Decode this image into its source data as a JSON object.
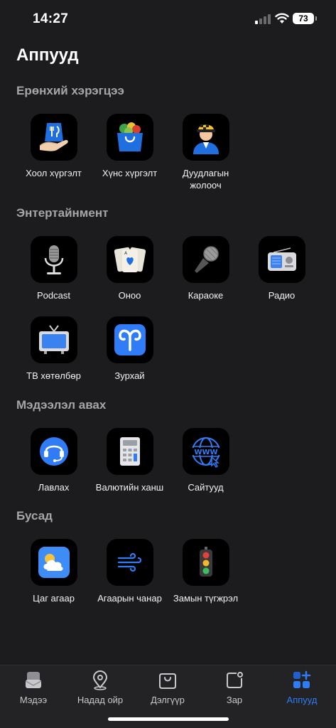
{
  "status": {
    "time": "14:27",
    "battery": "73"
  },
  "page": {
    "title": "Аппууд"
  },
  "sections": [
    {
      "title": "Ерөнхий хэрэгцээ",
      "apps": [
        {
          "label": "Хоол хүргэлт",
          "icon": "food-delivery-icon"
        },
        {
          "label": "Хүнс хүргэлт",
          "icon": "grocery-bag-icon"
        },
        {
          "label": "Дуудлагын жолооч",
          "icon": "driver-icon"
        }
      ]
    },
    {
      "title": "Энтертайнмент",
      "apps": [
        {
          "label": "Podcast",
          "icon": "microphone-icon"
        },
        {
          "label": "Оноо",
          "icon": "playing-cards-icon"
        },
        {
          "label": "Караоке",
          "icon": "karaoke-mic-icon"
        },
        {
          "label": "Радио",
          "icon": "radio-icon"
        },
        {
          "label": "ТВ хөтөлбөр",
          "icon": "tv-icon"
        },
        {
          "label": "Зурхай",
          "icon": "aries-icon"
        }
      ]
    },
    {
      "title": "Мэдээлэл авах",
      "apps": [
        {
          "label": "Лавлах",
          "icon": "headset-icon"
        },
        {
          "label": "Валютийн ханш",
          "icon": "calculator-icon"
        },
        {
          "label": "Сайтууд",
          "icon": "www-icon"
        }
      ]
    },
    {
      "title": "Бусад",
      "apps": [
        {
          "label": "Цаг агаар",
          "icon": "weather-icon"
        },
        {
          "label": "Агаарын чанар",
          "icon": "wind-icon"
        },
        {
          "label": "Замын түгжрэл",
          "icon": "traffic-light-icon"
        }
      ]
    }
  ],
  "tabs": [
    {
      "label": "Мэдээ",
      "icon": "news-icon",
      "active": false
    },
    {
      "label": "Надад ойр",
      "icon": "location-pin-icon",
      "active": false
    },
    {
      "label": "Дэлгүүр",
      "icon": "shopping-bag-icon",
      "active": false
    },
    {
      "label": "Зар",
      "icon": "ads-icon",
      "active": false
    },
    {
      "label": "Аппууд",
      "icon": "apps-grid-icon",
      "active": true
    }
  ],
  "colors": {
    "background": "#1c1c1e",
    "section_title": "#a6a6aa",
    "accent": "#2f7cf6",
    "tabbar": "#232325"
  }
}
